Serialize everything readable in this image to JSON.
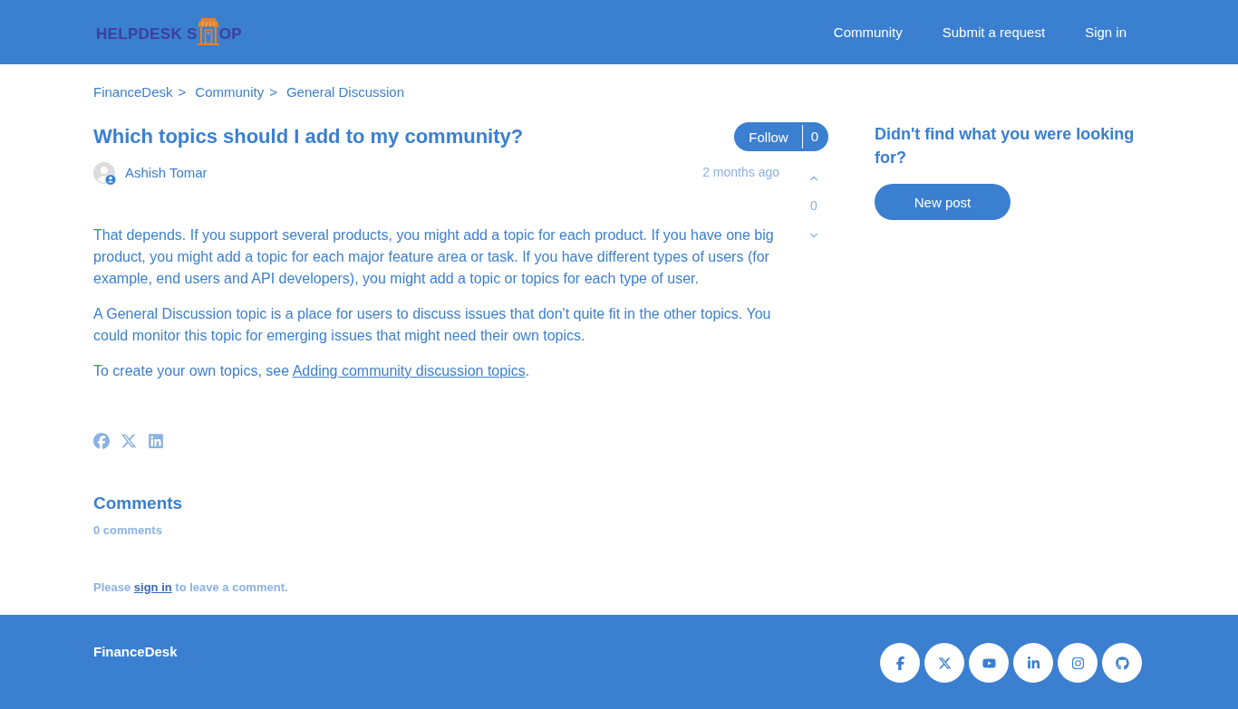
{
  "header": {
    "logo": {
      "text_start": "HELPDESK S",
      "text_end": "OP"
    },
    "nav": [
      "Community",
      "Submit a request",
      "Sign in"
    ]
  },
  "breadcrumb": [
    {
      "label": "FinanceDesk",
      "separator": ">"
    },
    {
      "label": "Community",
      "separator": ">"
    },
    {
      "label": "General Discussion"
    }
  ],
  "post": {
    "title": "Which topics should I add to my community?",
    "follow": {
      "label": "Follow",
      "count": "0"
    },
    "author": "Ashish Tomar",
    "time": "2 months ago",
    "votes": "0",
    "paragraphs": [
      {
        "text": "That depends. If you support several products, you might add a topic for each product. If you have one big product, you might add a topic for each major feature area or task. If you have different types of users (for example, end users and API developers), you might add a topic or topics for each type of user."
      },
      {
        "text": "A General Discussion topic is a place for users to discuss issues that don't quite fit in the other topics. You could monitor this topic for emerging issues that might need their own topics."
      },
      {
        "text": "To create your own topics, see ",
        "link": "Adding community discussion topics",
        "after": "."
      }
    ],
    "share": [
      {
        "kind": "facebook"
      },
      {
        "kind": "x"
      },
      {
        "kind": "linkedin"
      }
    ]
  },
  "comments": {
    "heading": "Comments",
    "count": "0 comments",
    "prompt": {
      "before": "Please ",
      "link": "sign in",
      "after": " to leave a comment."
    }
  },
  "sidebar": {
    "heading": "Didn't find what you were looking for?",
    "button": "New post"
  },
  "footer": {
    "brand": "FinanceDesk",
    "social": [
      {
        "kind": "facebook"
      },
      {
        "kind": "x"
      },
      {
        "kind": "youtube"
      },
      {
        "kind": "linkedin"
      },
      {
        "kind": "instagram"
      },
      {
        "kind": "github"
      }
    ]
  }
}
